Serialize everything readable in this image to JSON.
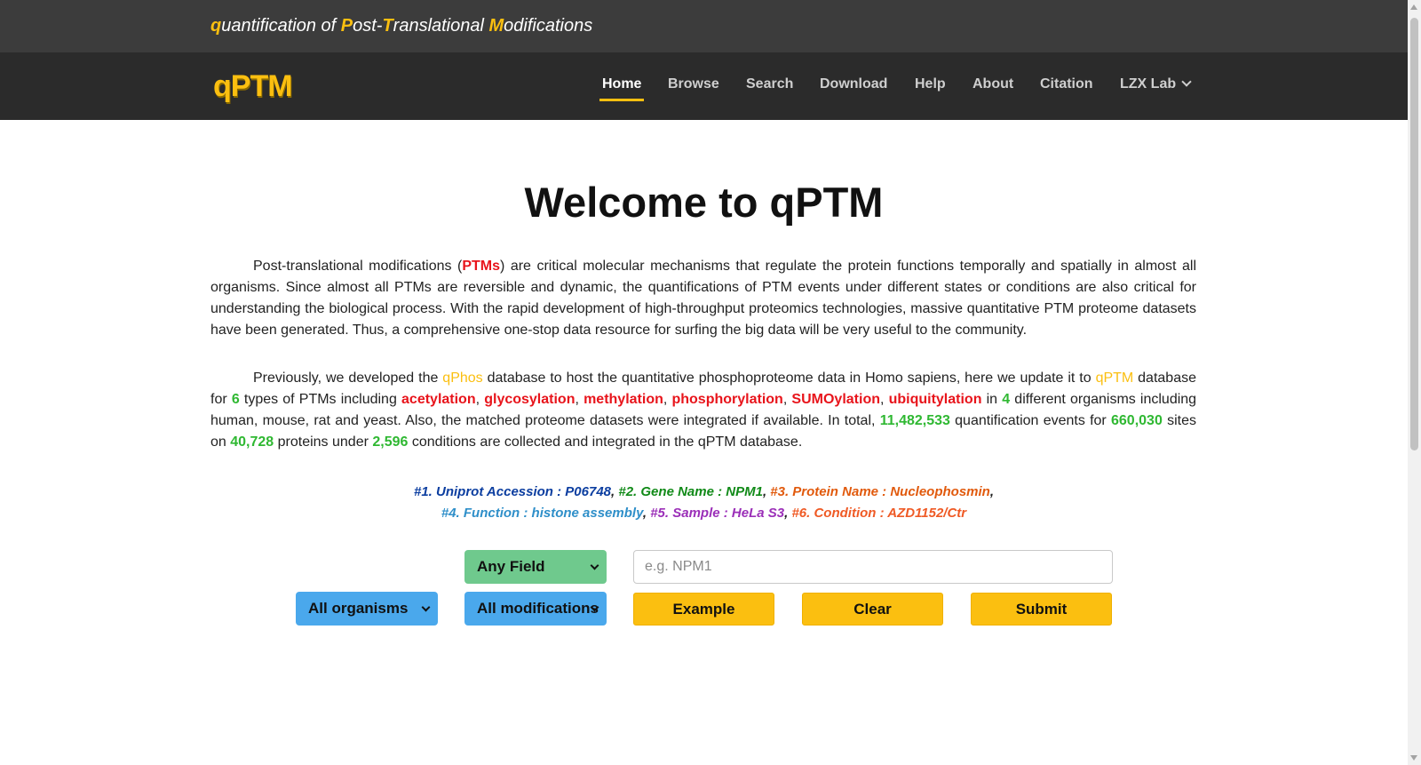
{
  "tagline": {
    "q": "q",
    "q_rest": "uantification of ",
    "p": "P",
    "p_rest": "ost-",
    "t": "T",
    "t_rest": "ranslational ",
    "m": "M",
    "m_rest": "odifications"
  },
  "logo": "qPTM",
  "nav": {
    "items": [
      "Home",
      "Browse",
      "Search",
      "Download",
      "Help",
      "About",
      "Citation",
      "LZX Lab"
    ],
    "active": "Home"
  },
  "welcome": "Welcome to qPTM",
  "paragraph1": {
    "a": "Post-translational modifications (",
    "ptms": "PTMs",
    "b": ") are critical molecular mechanisms that regulate the protein functions temporally and spatially in almost all organisms. Since almost all PTMs are reversible and dynamic, the quantifications of PTM events under different states or conditions are also critical for understanding the biological process. With the rapid development of high-throughput proteomics technologies, massive quantitative PTM proteome datasets have been generated. Thus, a comprehensive one-stop data resource for surfing the big data will be very useful to the community."
  },
  "paragraph2": {
    "a": "Previously, we developed the ",
    "qphos": "qPhos",
    "b": " database to host the quantitative phosphoproteome data in Homo sapiens, here we update it to ",
    "qptm": "qPTM",
    "c": " database for ",
    "ptm_types": "6",
    "d": " types of PTMs including ",
    "mods": [
      "acetylation",
      "glycosylation",
      "methylation",
      "phosphorylation",
      "SUMOylation",
      "ubiquitylation"
    ],
    "sep": ", ",
    "e": " in ",
    "organisms": "4",
    "f": " different organisms including human, mouse, rat and yeast. Also, the matched proteome datasets were integrated if available. In total, ",
    "events": "11,482,533",
    "g": " quantification events for ",
    "sites": "660,030",
    "h": " sites on ",
    "proteins": "40,728",
    "i": " proteins under ",
    "conditions": "2,596",
    "j": " conditions are collected and integrated in the qPTM database."
  },
  "examples": {
    "ex1": "#1. Uniprot Accession : P06748",
    "ex2": "#2. Gene Name : NPM1",
    "ex3": "#3. Protein Name : Nucleophosmin",
    "ex4": "#4. Function : histone assembly",
    "ex5": "#5. Sample : HeLa S3",
    "ex6": "#6. Condition : AZD1152/Ctr",
    "sep": ", ",
    "end": ","
  },
  "search": {
    "field_select": "Any Field",
    "organism_select": "All organisms",
    "modification_select": "All modifications",
    "placeholder": "e.g. NPM1",
    "example_button": "Example",
    "clear_button": "Clear",
    "submit_button": "Submit"
  },
  "colors": {
    "accent_gold": "#fbbf10",
    "highlight_red": "#e8141b",
    "number_green": "#2fb832",
    "select_green": "#6fc98d",
    "select_blue": "#4aa8ec",
    "topbar": "#3c3c3c",
    "navbar": "#2b2b2b"
  }
}
